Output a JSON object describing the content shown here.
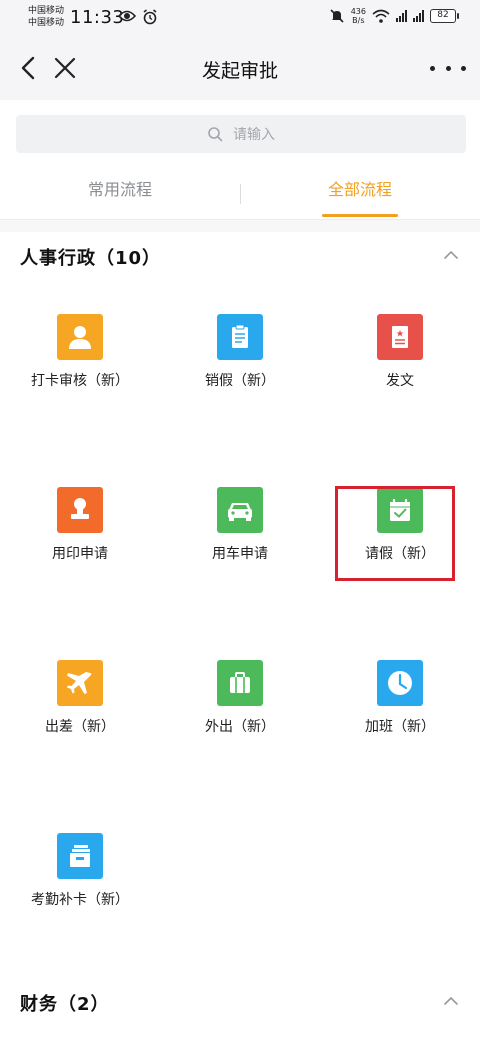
{
  "status_bar": {
    "carrier_1": "中国移动",
    "carrier_2": "中国移动",
    "time": "11:33",
    "net_speed_value": "436",
    "net_speed_unit": "B/s",
    "signal_tag_1": "4G",
    "signal_tag_2": "4G",
    "battery": "82"
  },
  "nav": {
    "title": "发起审批"
  },
  "search": {
    "placeholder": "请输入"
  },
  "tabs": [
    {
      "label": "常用流程",
      "active": false
    },
    {
      "label": "全部流程",
      "active": true
    }
  ],
  "colors": {
    "accent": "#f2a020",
    "highlight": "#d6232f",
    "orange_tile": "#f6a623",
    "blue_tile": "#2aa8ee",
    "red_tile": "#e8504a",
    "deep_orange_tile": "#f26b2a",
    "green_tile": "#4cba5a"
  },
  "sections": [
    {
      "title": "人事行政（10）",
      "items": [
        {
          "label": "打卡审核（新）",
          "icon": "person-icon",
          "color": "#f6a623"
        },
        {
          "label": "销假（新）",
          "icon": "clipboard-icon",
          "color": "#2aa8ee"
        },
        {
          "label": "发文",
          "icon": "document-icon",
          "color": "#e8504a"
        },
        {
          "label": "用印申请",
          "icon": "stamp-icon",
          "color": "#f26b2a"
        },
        {
          "label": "用车申请",
          "icon": "car-icon",
          "color": "#4cba5a"
        },
        {
          "label": "请假（新）",
          "icon": "calendar-check-icon",
          "color": "#4cba5a"
        },
        {
          "label": "出差（新）",
          "icon": "airplane-icon",
          "color": "#f6a623"
        },
        {
          "label": "外出（新）",
          "icon": "briefcase-icon",
          "color": "#4cba5a"
        },
        {
          "label": "加班（新）",
          "icon": "clock-icon",
          "color": "#2aa8ee"
        },
        {
          "label": "考勤补卡（新）",
          "icon": "card-stack-icon",
          "color": "#2aa8ee"
        }
      ]
    },
    {
      "title": "财务（2）",
      "items": []
    }
  ]
}
